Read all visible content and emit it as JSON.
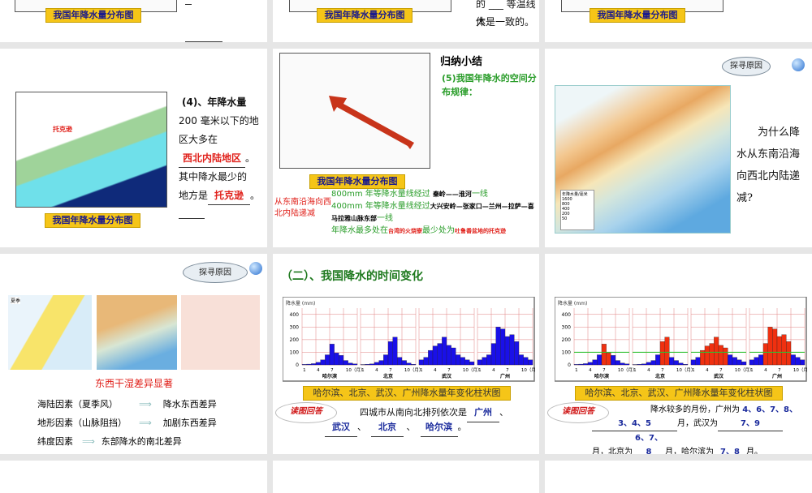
{
  "slides": {
    "s1": {
      "caption": "我国年降水量分布图"
    },
    "s2": {
      "caption": "我国年降水量分布图",
      "text1": "的 ___ 等温线大",
      "text2": "体是一致的。"
    },
    "s3": {
      "caption": "我国年降水量分布图"
    },
    "s4": {
      "caption": "我国年降水量分布图",
      "map_label": "托克逊",
      "q1": "(4)、年降水量",
      "q2": "200 毫米以下的地",
      "q3": "区大多在",
      "a1": "西北内陆地区",
      "q4": "其中降水最少的",
      "q5": "地方是",
      "a2": "托克逊",
      "end": "。"
    },
    "s5": {
      "title": "归纳小结",
      "subtitle": "(5)我国年降水的空间分布规律：",
      "caption": "我国年降水量分布图",
      "left": "从东南沿海向西北内陆递减",
      "l1": "800mm 年等降水量线经过",
      "l1a": "秦岭——淮河",
      "l1b": "一线",
      "l2": "400mm 年等降水量线经过",
      "l2a": "大兴安岭—张家口—兰州—拉萨—喜马拉雅山脉东部",
      "l2b": "一线",
      "l3": "年降水最多处在",
      "l3a": "台湾的火烧寮",
      "l3b": "最少处为",
      "l3c": "吐鲁番盆地的托克逊"
    },
    "s6": {
      "cloud": "探寻原因",
      "q": "为什么降水从东南沿海向西北内陆递减?",
      "legend_title": "年降水量/毫米",
      "legend": [
        "1600",
        "800",
        "400",
        "200",
        "50"
      ]
    },
    "s7": {
      "cloud": "探寻原因",
      "map_label": "夏季",
      "heading": "东西干湿差异显著",
      "rows": [
        {
          "a": "海陆因素（夏季风）",
          "b": "降水东西差异"
        },
        {
          "a": "地形因素（山脉阻挡）",
          "b": "加剧东西差异"
        },
        {
          "a": "纬度因素",
          "b": "东部降水的南北差异"
        }
      ]
    },
    "s8": {
      "title": "（二）、我国降水的时间变化",
      "caption": "哈尔滨、北京、武汉、广州降水量年变化柱状图",
      "bubble": "读图回答",
      "q": "四城市从南向北排列依次是",
      "answers": [
        "广州",
        "武汉",
        "北京",
        "哈尔滨"
      ]
    },
    "s9": {
      "caption": "哈尔滨、北京、武汉、广州降水量年变化柱状图",
      "bubble": "读图回答",
      "q1": "降水较多的月份，广州为",
      "a1": "4、6、7、8、",
      "a1b": "3、4、5",
      "q2": "月，武汉为",
      "a2": "7、9",
      "q3": "月，北京为",
      "a3": "6、7、8",
      "q4": "月，哈尔滨为",
      "a4": "7、8",
      "end": "月。"
    }
  },
  "chart_data": {
    "type": "bar",
    "title": "哈尔滨、北京、武汉、广州降水量年变化柱状图",
    "ylabel": "降水量 (mm)",
    "ylim": [
      0,
      450
    ],
    "yticks": [
      0,
      100,
      200,
      300,
      400
    ],
    "xticks": [
      "1",
      "4",
      "7",
      "10（月）"
    ],
    "threshold": 100,
    "series": [
      {
        "name": "哈尔滨",
        "values": [
          4,
          6,
          10,
          20,
          40,
          80,
          165,
          95,
          75,
          35,
          15,
          8
        ],
        "highlight": [
          7,
          8
        ]
      },
      {
        "name": "北京",
        "values": [
          3,
          5,
          8,
          20,
          35,
          80,
          185,
          220,
          60,
          35,
          15,
          5
        ],
        "highlight": [
          7,
          8
        ]
      },
      {
        "name": "武汉",
        "values": [
          40,
          60,
          115,
          150,
          170,
          220,
          155,
          135,
          80,
          60,
          40,
          25
        ],
        "highlight": [
          3,
          4,
          5,
          6,
          7,
          8
        ]
      },
      {
        "name": "广州",
        "values": [
          40,
          60,
          80,
          170,
          300,
          285,
          225,
          240,
          185,
          80,
          60,
          40
        ],
        "highlight": [
          4,
          5,
          6,
          7,
          8,
          9
        ]
      }
    ]
  }
}
